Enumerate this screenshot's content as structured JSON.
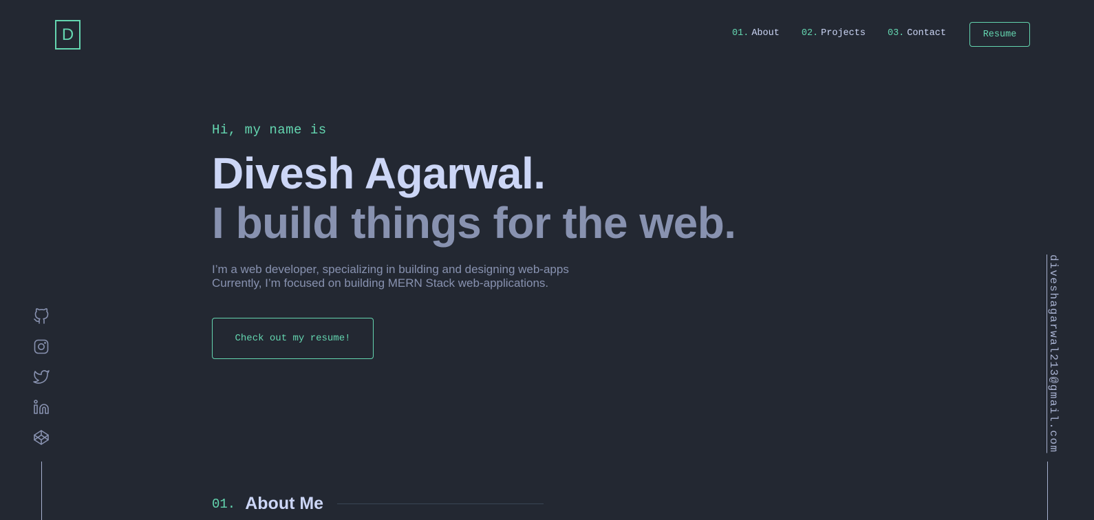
{
  "header": {
    "logo": "D",
    "nav": [
      {
        "num": "01.",
        "label": "About"
      },
      {
        "num": "02.",
        "label": "Projects"
      },
      {
        "num": "03.",
        "label": "Contact"
      }
    ],
    "resume_label": "Resume"
  },
  "hero": {
    "greeting": "Hi, my name is",
    "name": "Divesh Agarwal.",
    "tagline": "I build things for the web.",
    "desc_line1": "I’m a web developer, specializing in building and designing web-apps",
    "desc_line2": "Currently, I’m focused on building MERN Stack web-applications.",
    "cta": "Check out my resume!"
  },
  "social": [
    "github-icon",
    "instagram-icon",
    "twitter-icon",
    "linkedin-icon",
    "codepen-icon"
  ],
  "email": "diveshagarwal213@gmail.com",
  "about": {
    "num": "01.",
    "title": "About Me"
  },
  "colors": {
    "background": "#232832",
    "accent": "#64d6b0",
    "heading": "#ccd6f6",
    "muted": "#8892b0"
  }
}
